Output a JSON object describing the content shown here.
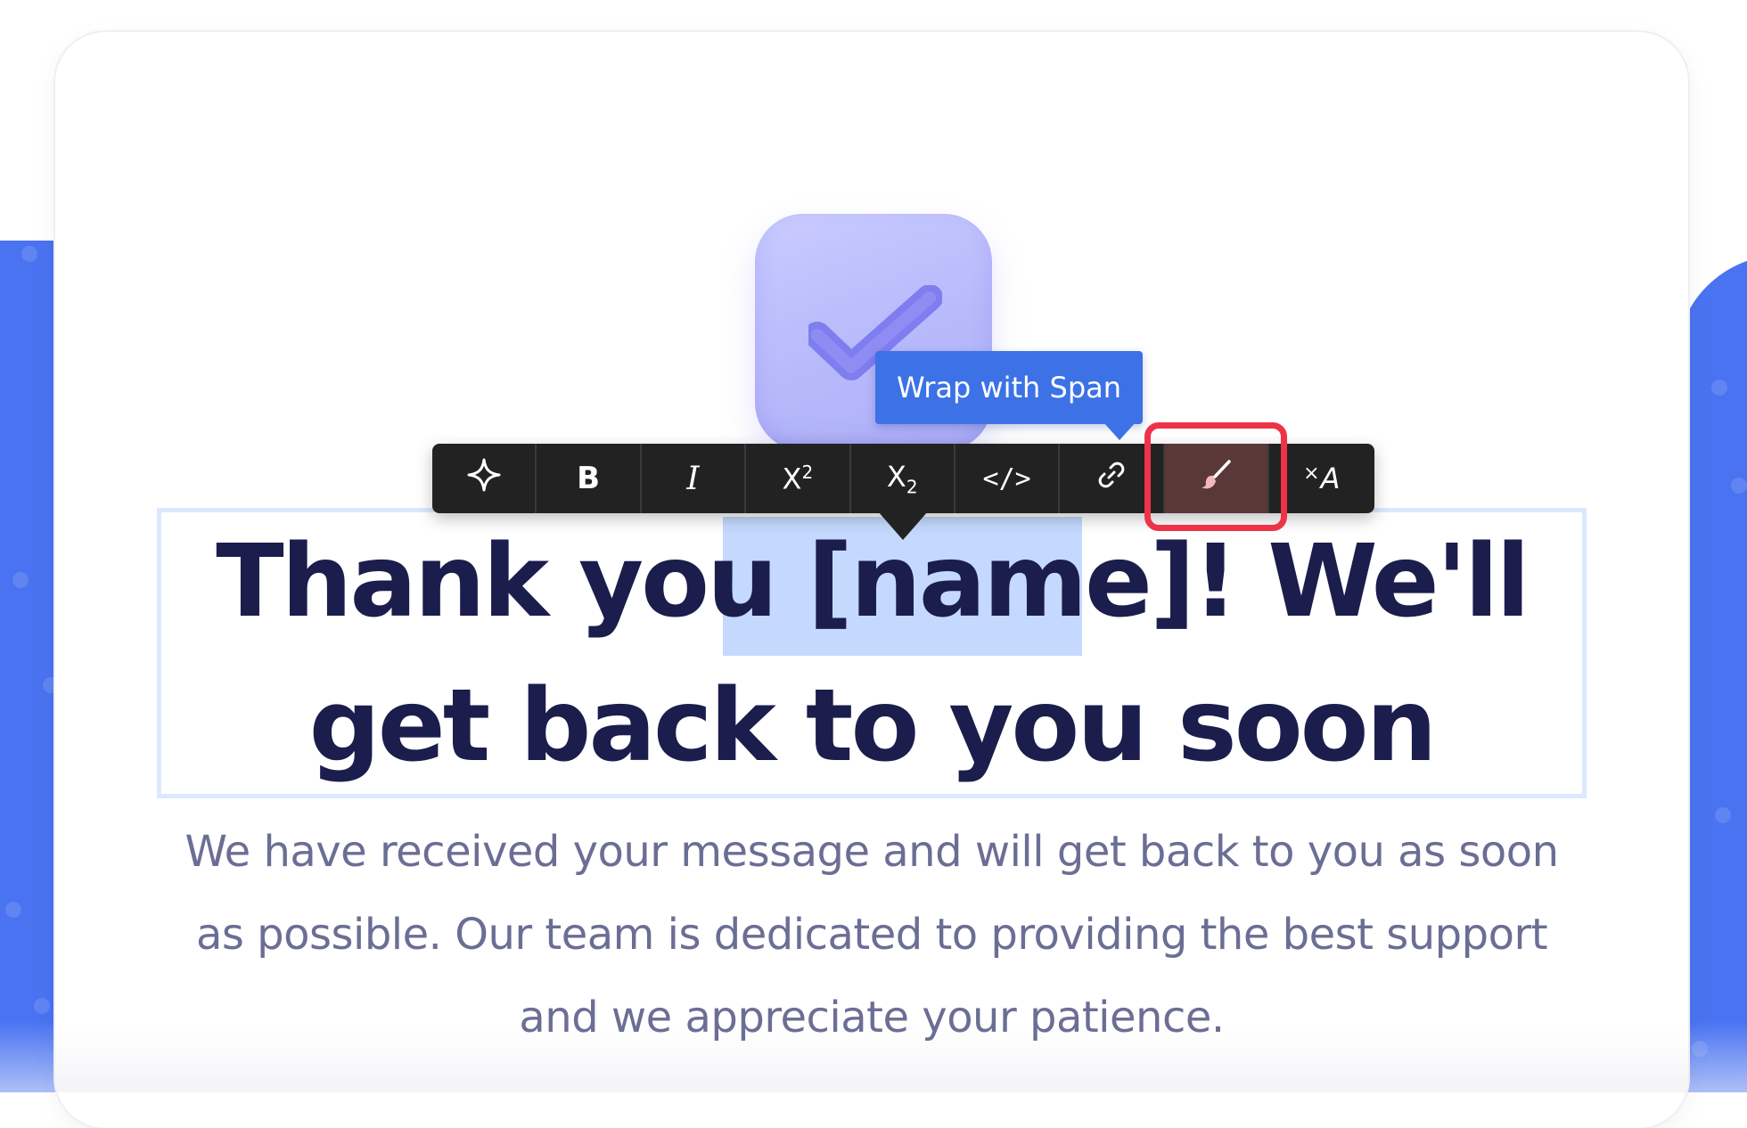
{
  "toolbar": {
    "buttons": [
      {
        "name": "ai-assist",
        "icon": "sparkle-icon",
        "label": ""
      },
      {
        "name": "bold",
        "icon": "bold-icon",
        "label": "B"
      },
      {
        "name": "italic",
        "icon": "italic-icon",
        "label": "I"
      },
      {
        "name": "superscript",
        "icon": "superscript-icon",
        "label": "X",
        "mark": "2"
      },
      {
        "name": "subscript",
        "icon": "subscript-icon",
        "label": "X",
        "mark": "2"
      },
      {
        "name": "code",
        "icon": "code-icon",
        "label": "</>"
      },
      {
        "name": "link",
        "icon": "link-icon",
        "label": ""
      },
      {
        "name": "wrap-span",
        "icon": "paintbrush-icon",
        "label": "",
        "active": true
      },
      {
        "name": "clear-format",
        "icon": "clear-format-icon",
        "label": "A",
        "mark": "×"
      }
    ]
  },
  "tooltip": {
    "text": "Wrap with Span"
  },
  "headline": {
    "prefix": "Thank you ",
    "highlighted": "[name]",
    "suffix": "! We'll get back to you soon"
  },
  "subtext": "We have received your message and will get back to you as soon as possible. Our team is dedicated to providing the best support and we appreciate your patience.",
  "colors": {
    "accent": "#4a73f1",
    "headline": "#1b1d4d",
    "body": "#6b6e94",
    "selection": "#c4d9fd",
    "highlight_ring": "#ee3348",
    "tooltip": "#3c72e6",
    "toolbar": "#222223"
  }
}
